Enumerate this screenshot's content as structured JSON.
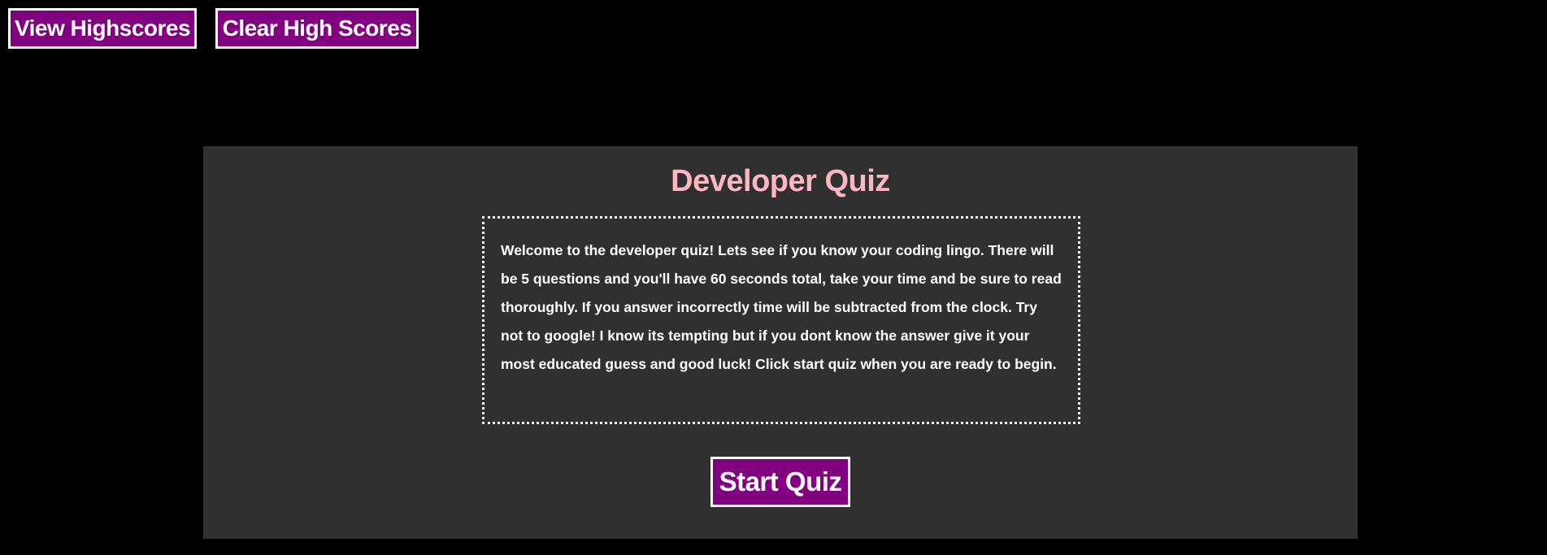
{
  "header": {
    "view_highscores_label": "View Highscores",
    "clear_highscores_label": "Clear High Scores"
  },
  "quiz": {
    "title": "Developer Quiz",
    "intro_text": "Welcome to the developer quiz! Lets see if you know your coding lingo. There will be 5 questions and you'll have 60 seconds total, take your time and be sure to read thoroughly. If you answer incorrectly time will be subtracted from the clock. Try not to google! I know its tempting but if you dont know the answer give it your most educated guess and good luck! Click start quiz when you are ready to begin.",
    "start_label": "Start Quiz"
  },
  "colors": {
    "background": "#000000",
    "panel": "#303030",
    "button": "#800080",
    "title": "#ffb6c1",
    "text": "#ffffff"
  }
}
